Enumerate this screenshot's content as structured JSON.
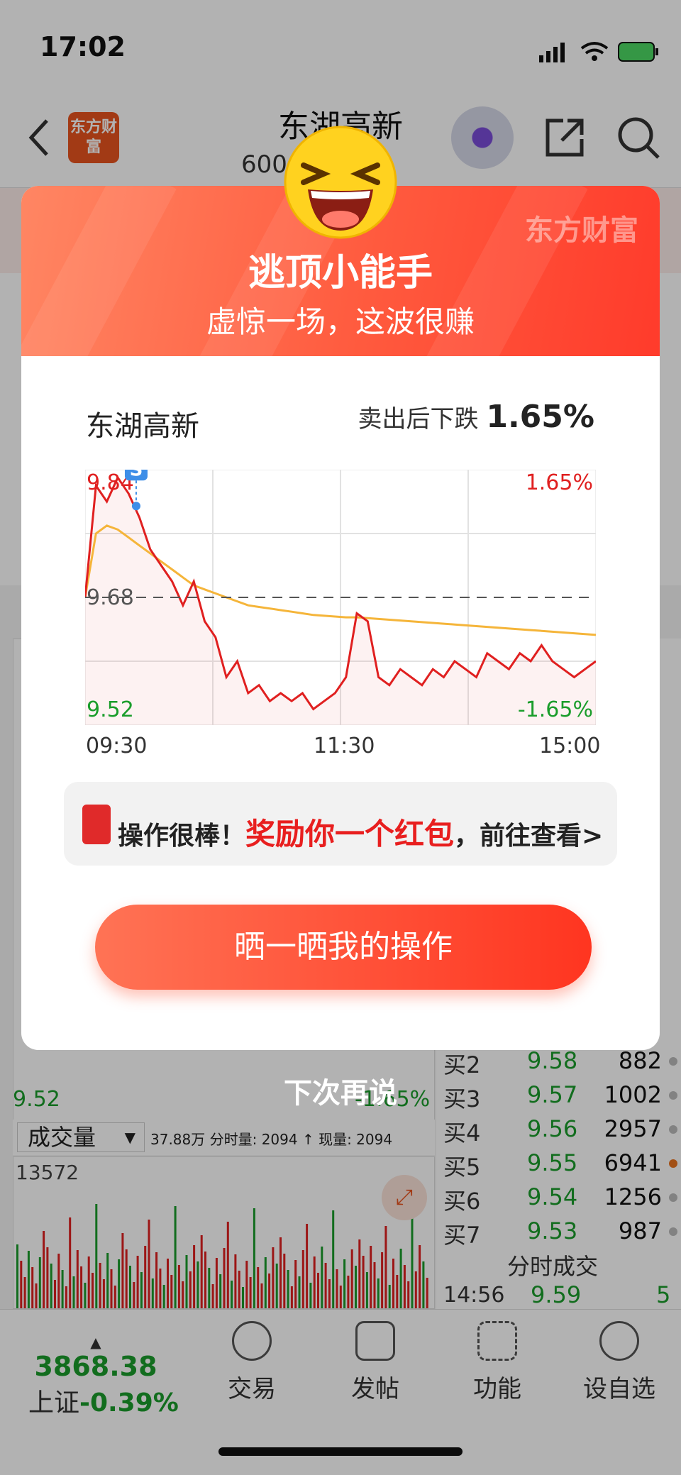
{
  "status_bar": {
    "time": "17:02"
  },
  "header": {
    "stock_name": "东湖高新",
    "stock_code": "600",
    "logo_text": "东方财富"
  },
  "depth_book": [
    {
      "label": "买2",
      "price": "9.58",
      "volume": "882"
    },
    {
      "label": "买3",
      "price": "9.57",
      "volume": "1002"
    },
    {
      "label": "买4",
      "price": "9.56",
      "volume": "2957"
    },
    {
      "label": "买5",
      "price": "9.55",
      "volume": "6941"
    },
    {
      "label": "买6",
      "price": "9.54",
      "volume": "1256"
    },
    {
      "label": "买7",
      "price": "9.53",
      "volume": "987"
    }
  ],
  "bg_chart": {
    "low_price": "9.52",
    "low_pct": "-1.65%"
  },
  "volume_bar": {
    "selector": "成交量",
    "summary": "37.88万 分时量: 2094 ↑ 现量: 2094",
    "max": "13572"
  },
  "trades": {
    "title": "分时成交",
    "row": {
      "time": "14:56",
      "price": "9.59",
      "volume": "5"
    }
  },
  "tabbar": {
    "index_value": "3868.38",
    "index_name": "上证",
    "index_pct": "-0.39%",
    "tabs": [
      {
        "label": "交易",
        "icon": "yuan-exchange-icon"
      },
      {
        "label": "发帖",
        "icon": "edit-post-icon"
      },
      {
        "label": "功能",
        "icon": "grid-functions-icon"
      },
      {
        "label": "设自选",
        "icon": "more-dots-icon"
      }
    ]
  },
  "modal": {
    "brand": "东方财富",
    "title": "逃顶小能手",
    "subtitle": "虚惊一场，这波很赚",
    "stock_name": "东湖高新",
    "drop_label": "卖出后下跌",
    "drop_pct": "1.65%",
    "reward_prefix": "操作很棒！",
    "reward_highlight": "奖励你一个红包",
    "reward_suffix": "，前往查看>",
    "share_button": "晒一晒我的操作",
    "dismiss": "下次再说"
  },
  "colors": {
    "accent": "#ff4a33",
    "up": "#e02020",
    "down": "#1a9d2b",
    "avg_line": "#f5b53a"
  },
  "chart_data": {
    "type": "line",
    "x_ticks": [
      "09:30",
      "11:30",
      "15:00"
    ],
    "y_top": "9.84",
    "y_mid": "9.68",
    "y_bottom": "9.52",
    "pct_top": "1.65%",
    "pct_bottom": "-1.65%",
    "sell_marker": "S",
    "ylim": [
      9.52,
      9.84
    ],
    "reference": 9.68,
    "series": [
      {
        "values": [
          9.68,
          9.82,
          9.8,
          9.83,
          9.81,
          9.78,
          9.74,
          9.72,
          9.7,
          9.67,
          9.7,
          9.65,
          9.63,
          9.58,
          9.6,
          9.56,
          9.57,
          9.55,
          9.56,
          9.55,
          9.56,
          9.54,
          9.55,
          9.56,
          9.58,
          9.66,
          9.65,
          9.58,
          9.57,
          9.59,
          9.58,
          9.57,
          9.59,
          9.58,
          9.6,
          9.59,
          9.58,
          9.61,
          9.6,
          9.59,
          9.61,
          9.6,
          9.62,
          9.6,
          9.59,
          9.58,
          9.59,
          9.6
        ]
      },
      {
        "values": [
          9.68,
          9.76,
          9.77,
          9.765,
          9.755,
          9.745,
          9.735,
          9.725,
          9.715,
          9.705,
          9.695,
          9.69,
          9.685,
          9.68,
          9.675,
          9.67,
          9.668,
          9.666,
          9.664,
          9.662,
          9.66,
          9.658,
          9.657,
          9.656,
          9.655,
          9.655,
          9.654,
          9.653,
          9.652,
          9.651,
          9.65,
          9.649,
          9.648,
          9.647,
          9.646,
          9.645,
          9.644,
          9.643,
          9.642,
          9.641,
          9.64,
          9.639,
          9.638,
          9.637,
          9.636,
          9.635,
          9.634,
          9.633
        ]
      }
    ]
  }
}
